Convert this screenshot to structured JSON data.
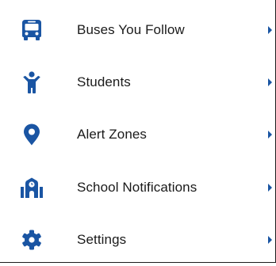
{
  "colors": {
    "icon": "#1a55a3",
    "chevron": "#1a55a3",
    "text": "#1a1a1a",
    "border": "#1c1c1c"
  },
  "menu": {
    "items": [
      {
        "label": "Buses You Follow",
        "icon": "bus-icon"
      },
      {
        "label": "Students",
        "icon": "child-icon"
      },
      {
        "label": "Alert Zones",
        "icon": "map-pin-icon"
      },
      {
        "label": "School Notifications",
        "icon": "school-icon"
      },
      {
        "label": "Settings",
        "icon": "gear-icon"
      }
    ]
  }
}
